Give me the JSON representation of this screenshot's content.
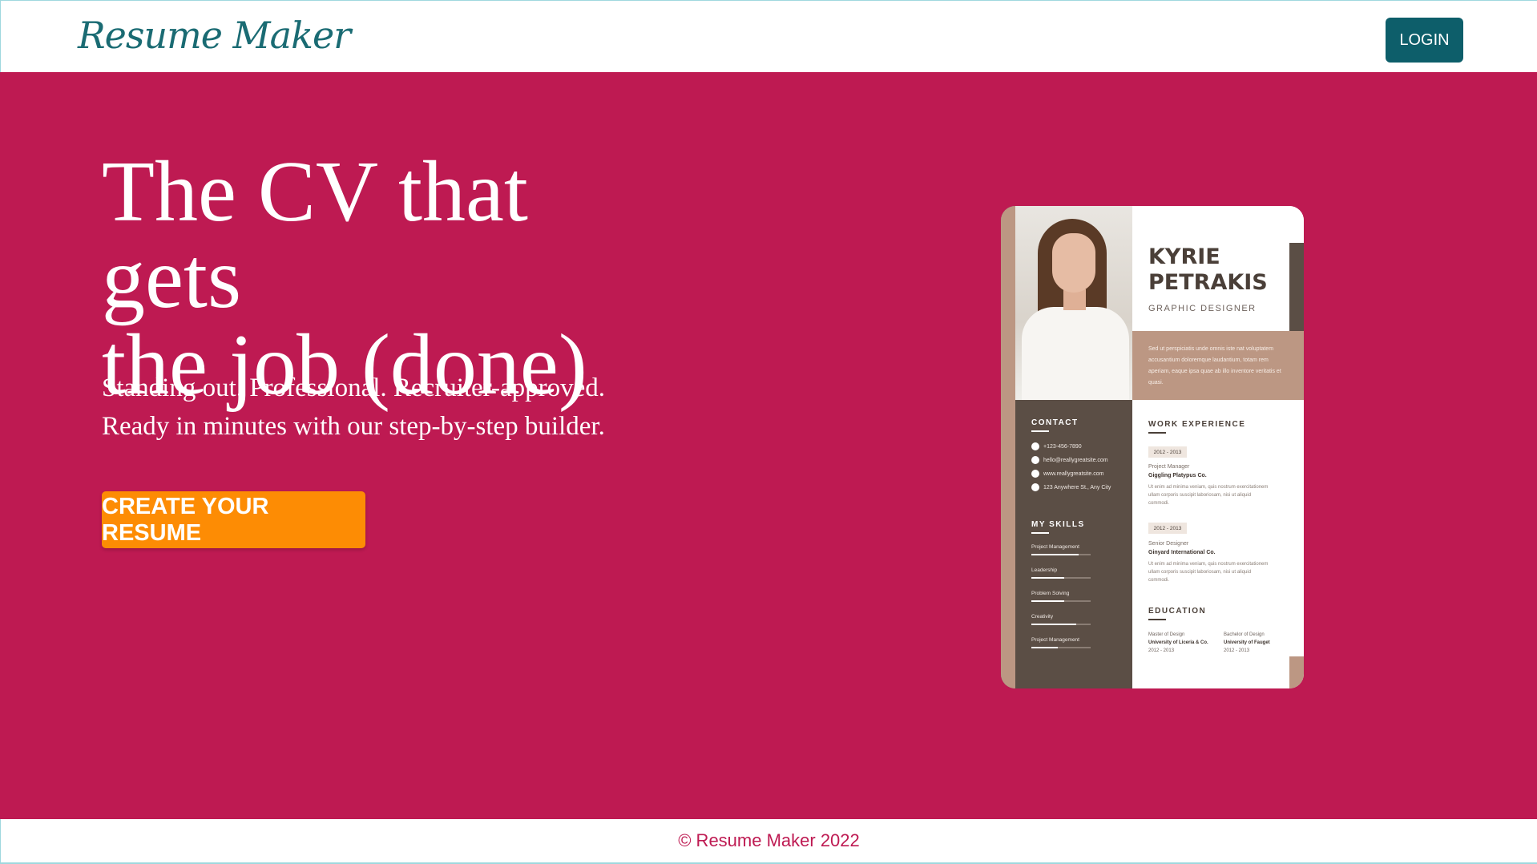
{
  "header": {
    "logo": "Resume Maker",
    "login_label": "LOGIN"
  },
  "hero": {
    "headline_line1": "The CV that gets",
    "headline_line2": "the job (done)",
    "subline_line1": "Standing out. Professional. Recruiter-approved.",
    "subline_line2": "Ready in minutes with our step-by-step builder.",
    "cta_label": "CREATE YOUR RESUME"
  },
  "resume_preview": {
    "first_name": "KYRIE",
    "last_name": "PETRAKIS",
    "job_title": "GRAPHIC DESIGNER",
    "about": "Sed ut perspiciatis unde omnis iste nat voluptatem accusantium doloremque laudantium, totam rem aperiam, eaque ipsa quae ab illo inventore veritatis et quasi.",
    "contact_heading": "CONTACT",
    "contacts": [
      "+123-456-7890",
      "hello@reallygreatsite.com",
      "www.reallygreatsite.com",
      "123 Anywhere St., Any City"
    ],
    "skills_heading": "MY SKILLS",
    "skills": [
      {
        "label": "Project Management",
        "level": 0.8
      },
      {
        "label": "Leadership",
        "level": 0.55
      },
      {
        "label": "Problem Solving",
        "level": 0.55
      },
      {
        "label": "Creativity",
        "level": 0.75
      },
      {
        "label": "Project Management",
        "level": 0.45
      }
    ],
    "work_heading": "WORK EXPERIENCE",
    "jobs": [
      {
        "dates": "2012 - 2013",
        "role": "Project Manager",
        "company": "Giggling Platypus Co.",
        "desc": "Ut enim ad minima veniam, quis nostrum exercitationem ullam corporis suscipit laboriosam, nisi ut aliquid commodi."
      },
      {
        "dates": "2012 - 2013",
        "role": "Senior Designer",
        "company": "Ginyard International Co.",
        "desc": "Ut enim ad minima veniam, quis nostrum exercitationem ullam corporis suscipit laboriosam, nisi ut aliquid commodi."
      }
    ],
    "education_heading": "EDUCATION",
    "education": [
      {
        "degree": "Master of Design",
        "school": "University of Liceria & Co.",
        "dates": "2012 - 2013"
      },
      {
        "degree": "Bachelor of Design",
        "school": "University of Fauget",
        "dates": "2012 - 2013"
      }
    ]
  },
  "footer": {
    "copyright": "© Resume Maker 2022"
  },
  "colors": {
    "hero_bg": "#be1a52",
    "login_bg": "#0d5e6a",
    "cta_bg": "#fd8c04",
    "logo": "#1a6b73"
  }
}
